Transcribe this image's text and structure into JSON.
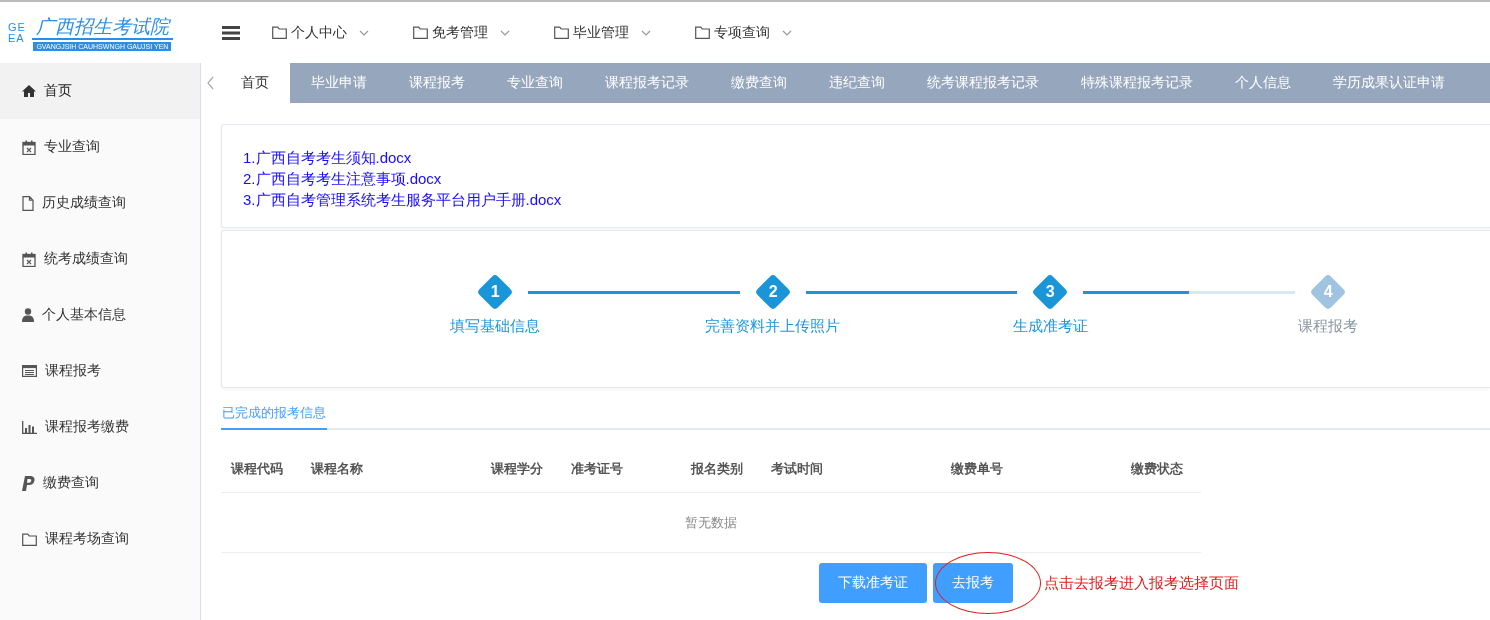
{
  "logo": {
    "mark_top": "GE",
    "mark_bottom": "EA",
    "title": "广西招生考试院",
    "subtitle": "GVANGJSIH CAUHSWNGH GAUJSI YEN"
  },
  "top_menu": [
    {
      "label": "个人中心"
    },
    {
      "label": "免考管理"
    },
    {
      "label": "毕业管理"
    },
    {
      "label": "专项查询"
    }
  ],
  "sidebar": {
    "items": [
      {
        "label": "首页",
        "selected": true
      },
      {
        "label": "专业查询",
        "selected": false
      },
      {
        "label": "历史成绩查询",
        "selected": false
      },
      {
        "label": "统考成绩查询",
        "selected": false
      },
      {
        "label": "个人基本信息",
        "selected": false
      },
      {
        "label": "课程报考",
        "selected": false
      },
      {
        "label": "课程报考缴费",
        "selected": false
      },
      {
        "label": "缴费查询",
        "selected": false
      },
      {
        "label": "课程考场查询",
        "selected": false
      }
    ]
  },
  "tabs": [
    {
      "label": "首页",
      "selected": true
    },
    {
      "label": "毕业申请",
      "selected": false
    },
    {
      "label": "课程报考",
      "selected": false
    },
    {
      "label": "专业查询",
      "selected": false
    },
    {
      "label": "课程报考记录",
      "selected": false
    },
    {
      "label": "缴费查询",
      "selected": false
    },
    {
      "label": "违纪查询",
      "selected": false
    },
    {
      "label": "统考课程报考记录",
      "selected": false
    },
    {
      "label": "特殊课程报考记录",
      "selected": false
    },
    {
      "label": "个人信息",
      "selected": false
    },
    {
      "label": "学历成果认证申请",
      "selected": false
    }
  ],
  "documents": [
    "1.广西自考考生须知.docx",
    "2.广西自考考生注意事项.docx",
    "3.广西自考管理系统考生服务平台用户手册.docx"
  ],
  "steps": [
    {
      "number": "1",
      "label": "填写基础信息",
      "done": true,
      "level": 1
    },
    {
      "number": "2",
      "label": "完善资料并上传照片",
      "done": true,
      "level": 1
    },
    {
      "number": "3",
      "label": "生成准考证",
      "done": true,
      "level": 0.5
    },
    {
      "number": "4",
      "label": "课程报考",
      "done": false
    }
  ],
  "section_tab": {
    "label": "已完成的报考信息",
    "selected": true
  },
  "table": {
    "columns": [
      "课程代码",
      "课程名称",
      "课程学分",
      "准考证号",
      "报名类别",
      "考试时间",
      "缴费单号",
      "缴费状态"
    ],
    "empty_text": "暂无数据"
  },
  "buttons": [
    "下载准考证",
    "去报考"
  ],
  "annotation": "点击去报考进入报考选择页面"
}
